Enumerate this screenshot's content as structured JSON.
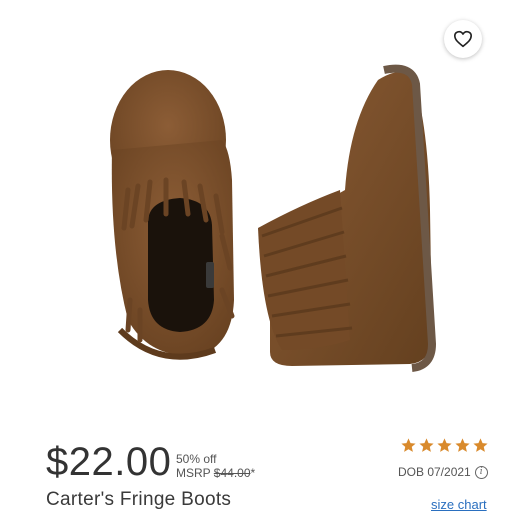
{
  "listing": {
    "price": "$22.00",
    "discount": "50% off",
    "msrp_label": "MSRP",
    "msrp_value": "$44.00",
    "msrp_mark": "*",
    "title": "Carter's Fringe Boots",
    "rating_stars": 5,
    "dob": "DOB 07/2021",
    "size_chart_label": "size chart"
  },
  "icons": {
    "favorite": "heart-icon",
    "info": "info-icon",
    "star": "star-icon"
  },
  "colors": {
    "star": "#d98a2c",
    "link": "#2a6fbf",
    "suede": "#7a4f2c"
  }
}
